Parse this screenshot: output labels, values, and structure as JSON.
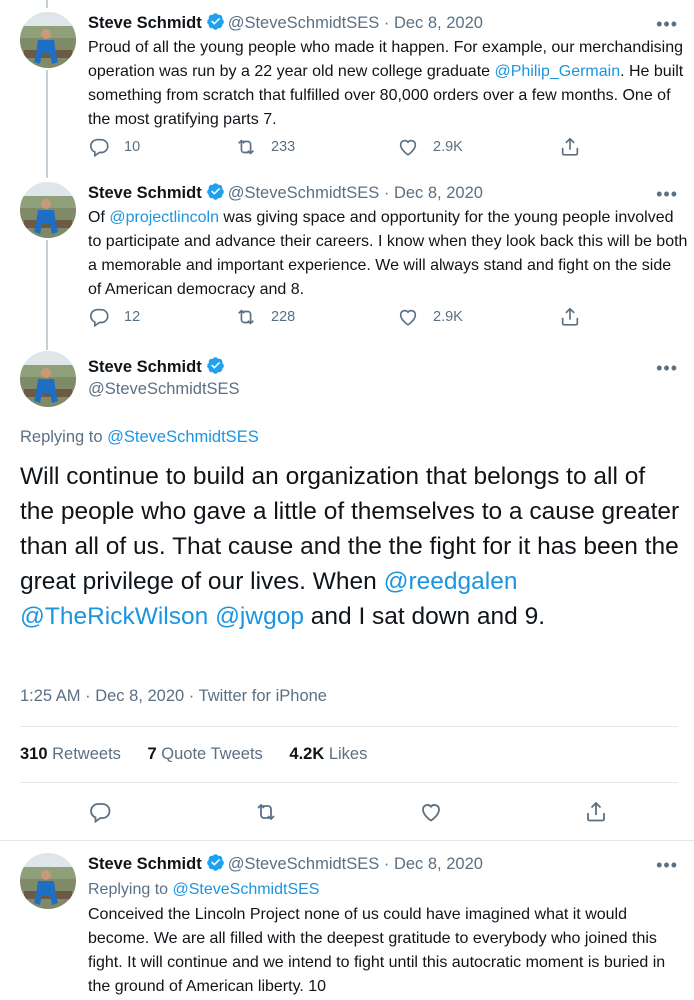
{
  "colors": {
    "link": "#1b95e0",
    "muted": "#5b7083",
    "verified": "#1da1f2",
    "thread_line": "#c4cfd6"
  },
  "tweets": [
    {
      "name": "Steve Schmidt",
      "handle": "@SteveSchmidtSES",
      "date": "Dec 8, 2020",
      "more": "•••",
      "text_parts": [
        "Proud of all the young people who made it happen. For example, our merchandising operation was run by a 22 year old new college graduate ",
        "@Philip_Germain",
        ".  He built something from scratch that fulfilled over 80,000 orders over a few months.  One of the most gratifying parts 7."
      ],
      "replies": "10",
      "retweets": "233",
      "likes": "2.9K"
    },
    {
      "name": "Steve Schmidt",
      "handle": "@SteveSchmidtSES",
      "date": "Dec 8, 2020",
      "more": "•••",
      "text_parts": [
        "Of ",
        "@projectlincoln",
        " was giving space and opportunity for the young people involved to participate and advance their careers.  I know when they look back this will be both a memorable and important experience. We will always stand and fight on the side of American democracy and 8."
      ],
      "replies": "12",
      "retweets": "228",
      "likes": "2.9K"
    }
  ],
  "main": {
    "name": "Steve Schmidt",
    "handle": "@SteveSchmidtSES",
    "more": "•••",
    "replying_label": "Replying to ",
    "replying_handle": "@SteveSchmidtSES",
    "text_a": "Will continue to build an organization that belongs to all of the people who gave a little of themselves to a cause greater than all of us. That cause and the the fight for it has been the great privilege of our lives. When ",
    "mention1": "@reedgalen",
    "mention2": "@TheRickWilson",
    "mention3": "@jwgop",
    "text_b": " and I sat down and 9.",
    "time": "1:25 AM",
    "date": "Dec 8, 2020",
    "source": "Twitter for iPhone",
    "retweets_count": "310",
    "retweets_label": "Retweets",
    "quotes_count": "7",
    "quotes_label": "Quote Tweets",
    "likes_count": "4.2K",
    "likes_label": "Likes"
  },
  "reply": {
    "name": "Steve Schmidt",
    "handle": "@SteveSchmidtSES",
    "date": "Dec 8, 2020",
    "more": "•••",
    "replying_label": "Replying to ",
    "replying_handle": "@SteveSchmidtSES",
    "text": "Conceived the Lincoln Project none of us could have imagined what it would become. We are all filled with the deepest gratitude to everybody who joined this fight. It will continue and we intend to fight until this autocratic moment is buried in the ground of American liberty. 10"
  },
  "separator": " · "
}
